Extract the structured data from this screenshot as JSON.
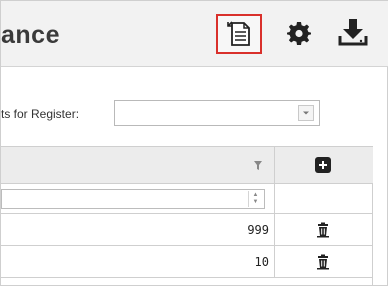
{
  "header": {
    "title": "ance",
    "icons": [
      "report-icon",
      "gear-icon",
      "download-icon"
    ]
  },
  "register": {
    "label": "ts for Register:",
    "selected_value": ""
  },
  "grid": {
    "rows": [
      {
        "quantity": "999"
      },
      {
        "quantity": "10"
      }
    ]
  },
  "colors": {
    "highlight_border": "#d9302b",
    "header_bg": "#f2f2f2",
    "grid_header_bg": "#ececec"
  }
}
